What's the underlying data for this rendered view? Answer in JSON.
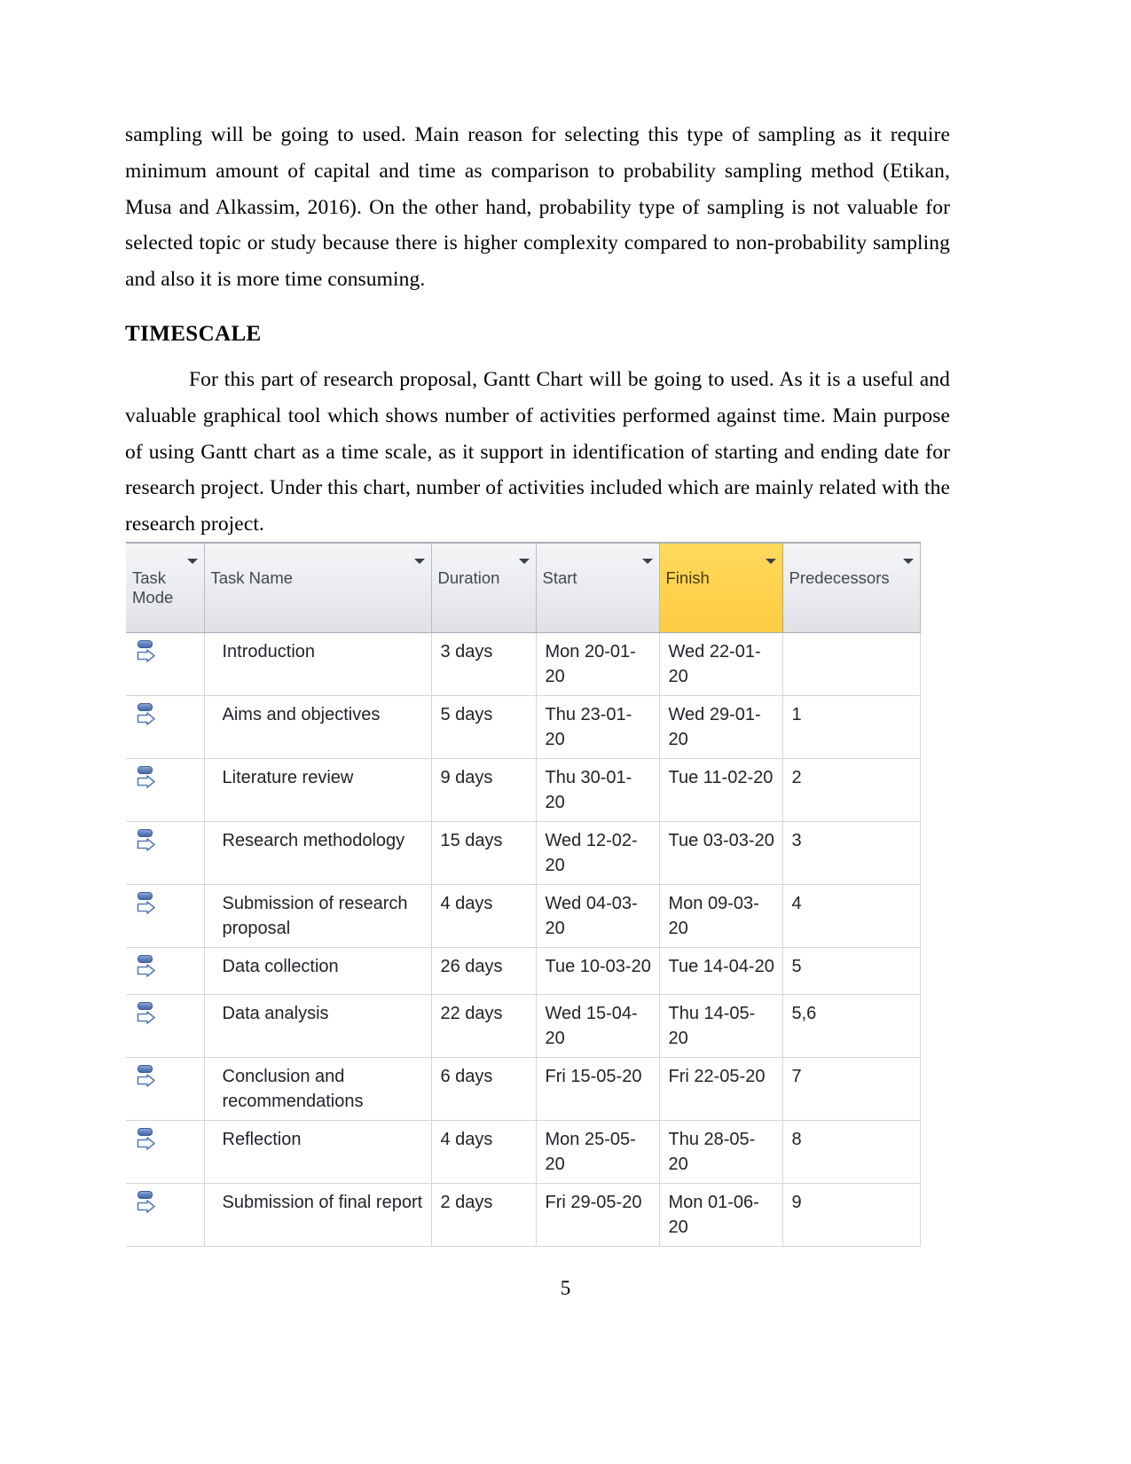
{
  "document": {
    "paragraph_1": "sampling will be going to used. Main reason for selecting this type of sampling as it require minimum amount of capital and time as comparison to probability sampling method (Etikan, Musa and Alkassim, 2016). On the other hand, probability type of sampling is not valuable for selected topic or study because there is higher complexity compared to non-probability sampling and also it is more time consuming.",
    "heading": "TIMESCALE",
    "paragraph_2": "For this part of research proposal, Gantt Chart will be going to used. As it is a useful and valuable graphical tool which shows number of activities performed against time. Main purpose of using Gantt chart as a time scale, as it support in identification of starting and ending date for research project. Under this chart, number of activities included which are mainly related with the research project.",
    "page_number": "5"
  },
  "gantt_table": {
    "highlight_color": "#ffd24d",
    "columns": [
      {
        "key": "mode",
        "label": "Task\nMode",
        "filter": true,
        "highlighted": false
      },
      {
        "key": "name",
        "label": "Task Name",
        "filter": true,
        "highlighted": false
      },
      {
        "key": "dur",
        "label": "Duration",
        "filter": true,
        "highlighted": false
      },
      {
        "key": "start",
        "label": "Start",
        "filter": true,
        "highlighted": false
      },
      {
        "key": "finish",
        "label": "Finish",
        "filter": true,
        "highlighted": true
      },
      {
        "key": "pred",
        "label": "Predecessors",
        "filter": true,
        "highlighted": false
      }
    ],
    "rows": [
      {
        "mode_icon": "manually-scheduled-icon",
        "name": "Introduction",
        "dur": "3 days",
        "start": "Mon 20-01-20",
        "finish": "Wed 22-01-20",
        "pred": ""
      },
      {
        "mode_icon": "manually-scheduled-icon",
        "name": "Aims and objectives",
        "dur": "5 days",
        "start": "Thu 23-01-20",
        "finish": "Wed 29-01-20",
        "pred": "1"
      },
      {
        "mode_icon": "manually-scheduled-icon",
        "name": "Literature review",
        "dur": "9 days",
        "start": "Thu 30-01-20",
        "finish": "Tue 11-02-20",
        "pred": "2"
      },
      {
        "mode_icon": "manually-scheduled-icon",
        "name": "Research methodology",
        "dur": "15 days",
        "start": "Wed 12-02-20",
        "finish": "Tue 03-03-20",
        "pred": "3"
      },
      {
        "mode_icon": "manually-scheduled-icon",
        "name": "Submission of research proposal",
        "dur": "4 days",
        "start": "Wed 04-03-20",
        "finish": "Mon 09-03-20",
        "pred": "4"
      },
      {
        "mode_icon": "manually-scheduled-icon",
        "name": "Data collection",
        "dur": "26 days",
        "start": "Tue 10-03-20",
        "finish": "Tue 14-04-20",
        "pred": "5"
      },
      {
        "mode_icon": "manually-scheduled-icon",
        "name": "Data analysis",
        "dur": "22 days",
        "start": "Wed 15-04-20",
        "finish": "Thu 14-05-20",
        "pred": "5,6"
      },
      {
        "mode_icon": "manually-scheduled-icon",
        "name": "Conclusion and recommendations",
        "dur": "6 days",
        "start": "Fri 15-05-20",
        "finish": "Fri 22-05-20",
        "pred": "7"
      },
      {
        "mode_icon": "manually-scheduled-icon",
        "name": "Reflection",
        "dur": "4 days",
        "start": "Mon 25-05-20",
        "finish": "Thu 28-05-20",
        "pred": "8"
      },
      {
        "mode_icon": "manually-scheduled-icon",
        "name": "Submission of final report",
        "dur": "2 days",
        "start": "Fri 29-05-20",
        "finish": "Mon 01-06-20",
        "pred": "9"
      }
    ]
  }
}
